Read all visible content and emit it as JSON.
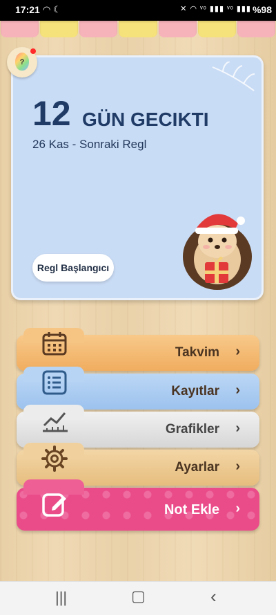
{
  "status_bar": {
    "time": "17:21",
    "left_icons": [
      "wifi-icon",
      "moon-icon"
    ],
    "right_icons": [
      "mute-icon",
      "wifi-icon",
      "volte1-icon",
      "signal-icon",
      "volte2-icon",
      "signal-icon"
    ],
    "battery": "%98"
  },
  "card": {
    "days_count": "12",
    "days_text": "GÜN GECIKTI",
    "next_period": "26 Kas - Sonraki Regl",
    "start_button": "Regl Başlangıcı"
  },
  "menu": {
    "items": [
      {
        "label": "Takvim",
        "icon": "calendar-icon"
      },
      {
        "label": "Kayıtlar",
        "icon": "list-icon"
      },
      {
        "label": "Grafikler",
        "icon": "chart-icon"
      },
      {
        "label": "Ayarlar",
        "icon": "gear-icon"
      },
      {
        "label": "Not Ekle",
        "icon": "edit-icon"
      }
    ]
  },
  "colors": {
    "card_bg": "#c9dcf5",
    "title": "#1f3b66",
    "note_tab": "#ea4c8a"
  },
  "nav": {
    "items": [
      "recent-apps-icon",
      "home-icon",
      "back-icon"
    ]
  }
}
